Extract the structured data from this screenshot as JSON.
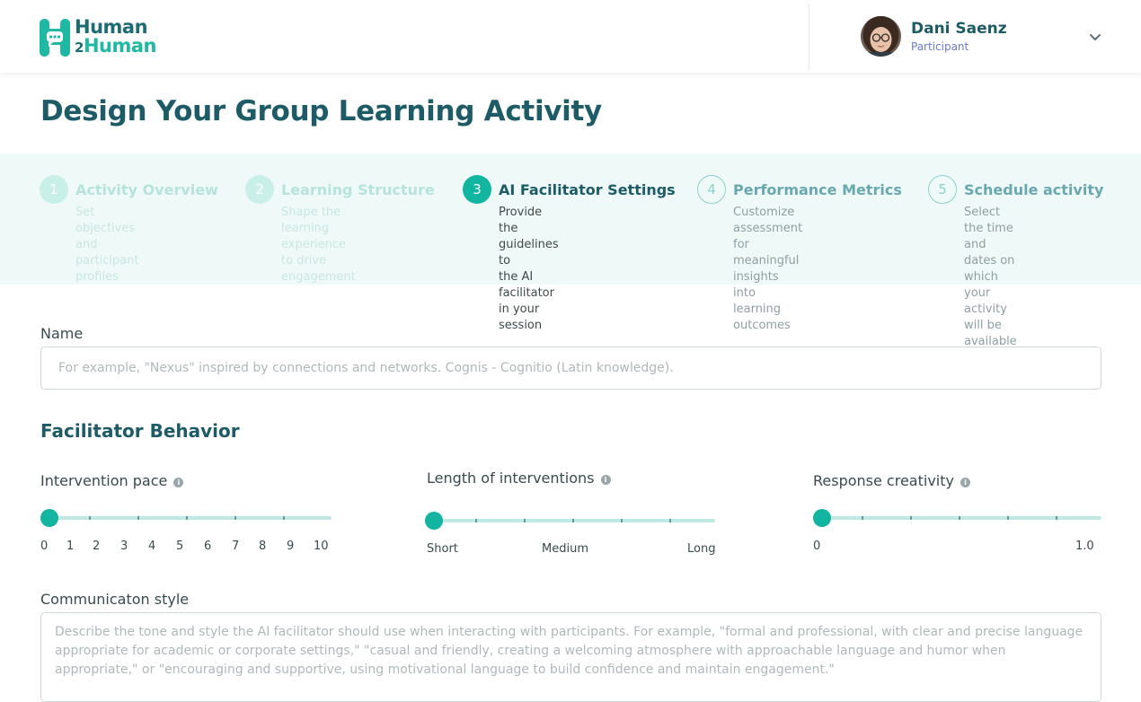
{
  "header": {
    "logo_line1": "Human",
    "logo_line2_num": "2",
    "logo_line2": "Human",
    "user_name": "Dani Saenz",
    "user_role": "Participant"
  },
  "page_title": "Design Your Group Learning Activity",
  "steps": [
    {
      "number": "1",
      "title": "Activity Overview",
      "desc_lines": [
        "Set objectives and",
        "participant profiles"
      ],
      "state": "done"
    },
    {
      "number": "2",
      "title": "Learning Structure",
      "desc_lines": [
        "Shape the learning",
        "experience to drive",
        "engagement"
      ],
      "state": "done"
    },
    {
      "number": "3",
      "title": "AI Facilitator Settings",
      "desc_lines": [
        "Provide the guidelines to",
        "the AI facilitator in your",
        "session"
      ],
      "state": "active"
    },
    {
      "number": "4",
      "title": "Performance Metrics",
      "desc_lines": [
        "Customize assessment",
        "for meaningful insights",
        "into learning outcomes"
      ],
      "state": "todo"
    },
    {
      "number": "5",
      "title": "Schedule activity",
      "desc_lines": [
        "Select the time and",
        "dates on which your",
        "activity will be available"
      ],
      "state": "todo"
    }
  ],
  "name_field": {
    "label": "Name",
    "placeholder": "For example, \"Nexus\"  inspired by connections and networks.   Cognis - Cognitio (Latin knowledge).",
    "value": ""
  },
  "facilitator": {
    "section_title": "Facilitator Behavior",
    "intervention_pace": {
      "label": "Intervention pace",
      "value": 0,
      "tick_labels": [
        "0",
        "1",
        "2",
        "3",
        "4",
        "5",
        "6",
        "7",
        "8",
        "9",
        "10"
      ]
    },
    "length": {
      "label": "Length of interventions",
      "value": "Short",
      "tick_labels": [
        "Short",
        "Medium",
        "Long"
      ]
    },
    "creativity": {
      "label": "Response creativity",
      "value": 0,
      "tick_labels": [
        "0",
        "1.0"
      ]
    }
  },
  "communication": {
    "label": "Communicaton style",
    "placeholder_lines": [
      "Describe the tone and style the AI facilitator should use when interacting with participants. For example, \"formal and professional, with clear and precise language",
      "appropriate for academic or corporate settings,\" \"casual and friendly, creating a welcoming atmosphere with approachable language and humor when",
      "appropriate,\" or \"encouraging and supportive, using motivational language to build confidence and maintain engagement.\""
    ]
  },
  "icons": {
    "logo": "chat-bubble-h-logo-icon",
    "dropdown": "chevron-down-icon",
    "info": "info-icon"
  },
  "colors": {
    "brand_dark": "#1d5c66",
    "brand_teal": "#12b5a0",
    "stepper_bg": "#effaf8",
    "role_purple": "#6a7bd6"
  }
}
